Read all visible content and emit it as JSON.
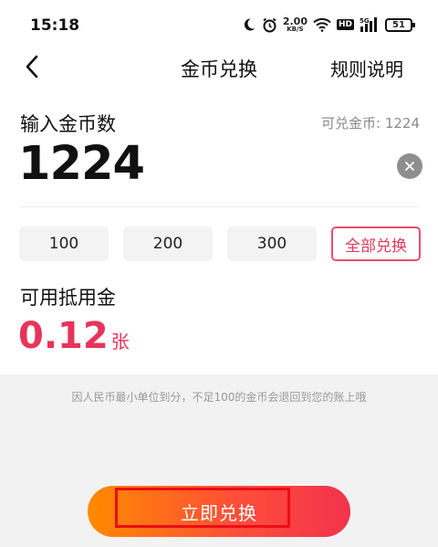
{
  "status_bar": {
    "time": "15:18",
    "net_speed_value": "2.00",
    "net_speed_unit": "KB/S",
    "hd": "HD",
    "signal_tech": "5G",
    "battery": "51"
  },
  "header": {
    "title": "金币兑换",
    "rules_link": "规则说明"
  },
  "input": {
    "label": "输入金币数",
    "available_label": "可兑金币: 1224",
    "value": "1224"
  },
  "quick_amounts": [
    "100",
    "200",
    "300"
  ],
  "all_button": "全部兑换",
  "deduction": {
    "label": "可用抵用金",
    "value": "0.12",
    "unit": "张"
  },
  "note": "因人民币最小单位到分，不足100的金币会退回到您的账上哦",
  "exchange_button": "立即兑换",
  "colors": {
    "accent": "#e8345b",
    "button_start": "#ff8a00",
    "button_end": "#f2334e"
  }
}
